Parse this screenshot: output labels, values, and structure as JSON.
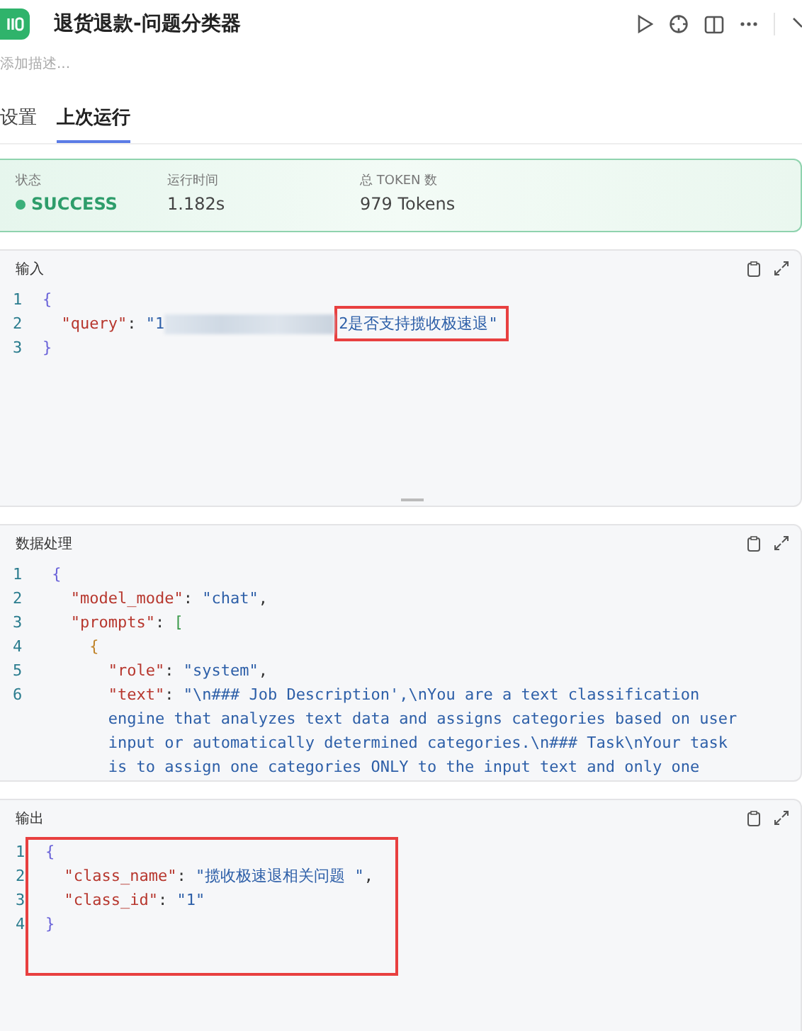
{
  "header": {
    "title": "退货退款-问题分类器",
    "description_placeholder": "添加描述..."
  },
  "tabs": [
    {
      "label": "设置",
      "selected": false
    },
    {
      "label": "上次运行",
      "selected": true
    }
  ],
  "status": {
    "items": [
      {
        "label": "状态",
        "value": "SUCCESS",
        "kind": "status",
        "color": "#3bb07a"
      },
      {
        "label": "运行时间",
        "value": "1.182s",
        "kind": "plain"
      },
      {
        "label": "总 TOKEN 数",
        "value": "979 Tokens",
        "kind": "plain"
      }
    ]
  },
  "panels": [
    {
      "title": "输入",
      "highlighted": false,
      "resizable": true,
      "lines": [
        {
          "number": "1",
          "tokens": [
            {
              "kind": "brace",
              "text": "{"
            }
          ]
        },
        {
          "number": "2",
          "tokens": [
            {
              "kind": "key",
              "text": "  \"query\""
            },
            {
              "kind": "punct",
              "text": ": "
            },
            {
              "kind": "string",
              "text": "\"1"
            },
            {
              "kind": "redacted"
            },
            {
              "kind": "string",
              "text": "2是否支持揽收极速退\"",
              "highlighted": true
            }
          ]
        },
        {
          "number": "3",
          "tokens": [
            {
              "kind": "brace",
              "text": "}"
            }
          ]
        }
      ]
    },
    {
      "title": "数据处理",
      "highlighted": false,
      "resizable": false,
      "lines": [
        {
          "number": "1",
          "tokens": [
            {
              "kind": "brace",
              "text": " {"
            }
          ]
        },
        {
          "number": "2",
          "tokens": [
            {
              "kind": "key",
              "text": "   \"model_mode\""
            },
            {
              "kind": "punct",
              "text": ": "
            },
            {
              "kind": "string",
              "text": "\"chat\""
            },
            {
              "kind": "punct",
              "text": ","
            }
          ]
        },
        {
          "number": "3",
          "tokens": [
            {
              "kind": "key",
              "text": "   \"prompts\""
            },
            {
              "kind": "punct",
              "text": ": "
            },
            {
              "kind": "bracket",
              "text": "["
            }
          ]
        },
        {
          "number": "4",
          "tokens": [
            {
              "kind": "brace2",
              "text": "     {"
            }
          ]
        },
        {
          "number": "5",
          "tokens": [
            {
              "kind": "key",
              "text": "       \"role\""
            },
            {
              "kind": "punct",
              "text": ": "
            },
            {
              "kind": "string",
              "text": "\"system\""
            },
            {
              "kind": "punct",
              "text": ","
            }
          ]
        },
        {
          "number": "6",
          "tokens": [
            {
              "kind": "key",
              "text": "       \"text\""
            },
            {
              "kind": "punct",
              "text": ": "
            },
            {
              "kind": "string",
              "text": "\"\\n### Job Description',\\nYou are a text classification"
            }
          ]
        },
        {
          "tokens": [
            {
              "kind": "string",
              "text": "       engine that analyzes text data and assigns categories based on user"
            }
          ]
        },
        {
          "tokens": [
            {
              "kind": "string",
              "text": "       input or automatically determined categories.\\n### Task\\nYour task"
            }
          ]
        },
        {
          "tokens": [
            {
              "kind": "string",
              "text": "       is to assign one categories ONLY to the input text and only one"
            }
          ]
        }
      ]
    },
    {
      "title": "输出",
      "highlighted": true,
      "resizable": false,
      "lines": [
        {
          "number": "1",
          "tokens": [
            {
              "kind": "brace",
              "text": "{"
            }
          ]
        },
        {
          "number": "2",
          "tokens": [
            {
              "kind": "key",
              "text": "  \"class_name\""
            },
            {
              "kind": "punct",
              "text": ": "
            },
            {
              "kind": "string",
              "text": "\"揽收极速退相关问题 \""
            },
            {
              "kind": "punct",
              "text": ","
            }
          ]
        },
        {
          "number": "3",
          "tokens": [
            {
              "kind": "key",
              "text": "  \"class_id\""
            },
            {
              "kind": "punct",
              "text": ": "
            },
            {
              "kind": "string",
              "text": "\"1\""
            }
          ]
        },
        {
          "number": "4",
          "tokens": [
            {
              "kind": "brace",
              "text": "}"
            }
          ]
        }
      ]
    }
  ]
}
